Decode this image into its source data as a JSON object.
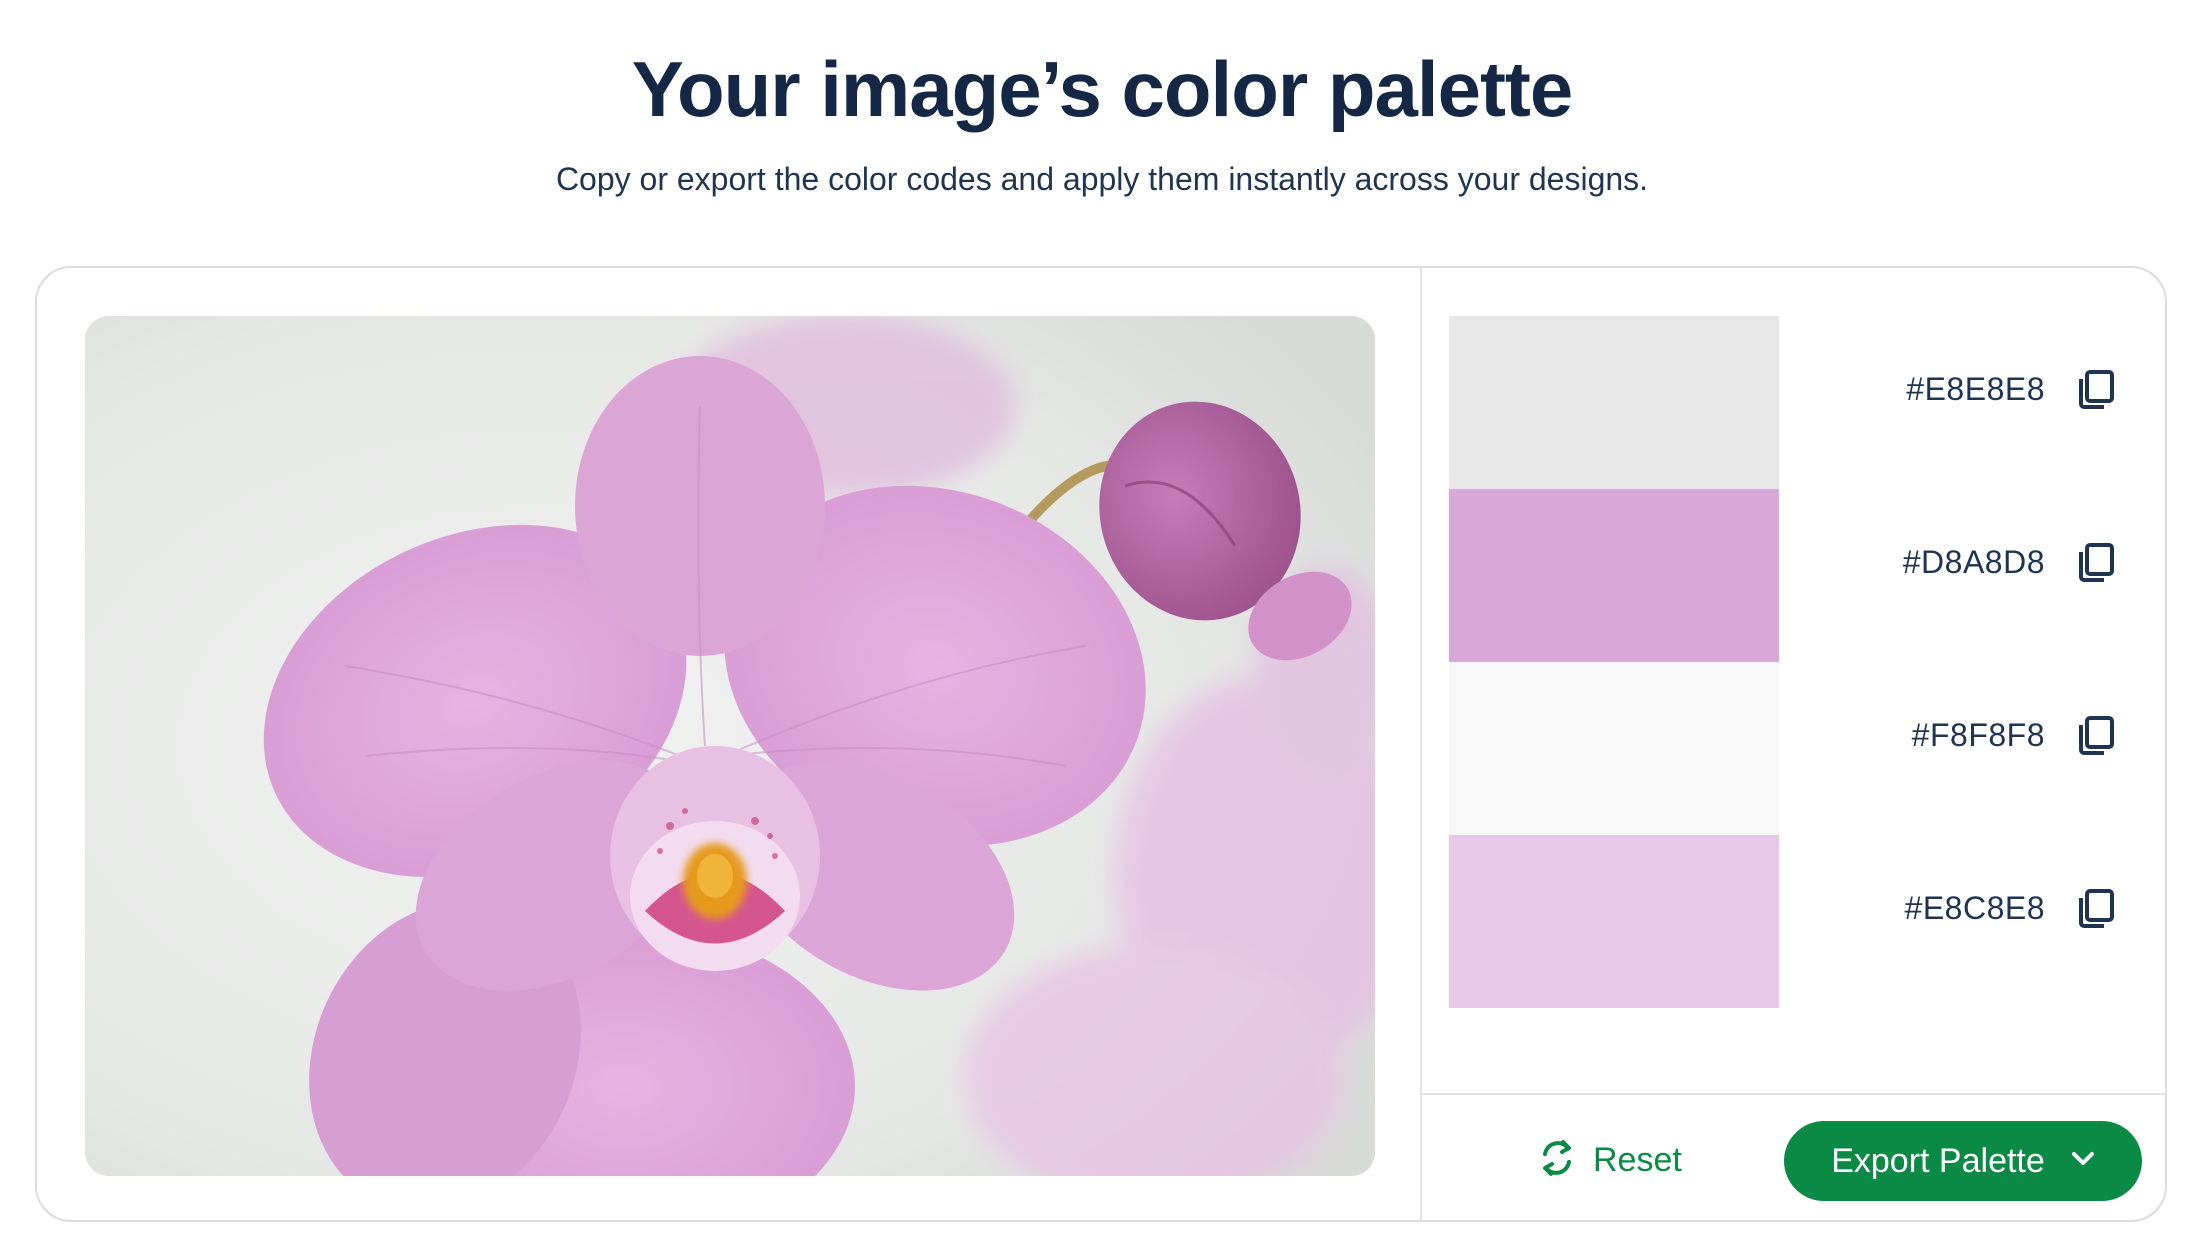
{
  "header": {
    "title": "Your image’s color palette",
    "subtitle": "Copy or export the color codes and apply them instantly across your designs."
  },
  "palette": [
    {
      "hex": "#E8E8E8",
      "color": "#E8E8E8",
      "icon": "copy-icon"
    },
    {
      "hex": "#D8A8D8",
      "color": "#D8A8D8",
      "icon": "copy-icon"
    },
    {
      "hex": "#F8F8F8",
      "color": "#F8F8F8",
      "icon": "copy-icon"
    },
    {
      "hex": "#E8C8E8",
      "color": "#E8C8E8",
      "icon": "copy-icon"
    }
  ],
  "actions": {
    "reset_label": "Reset",
    "reset_icon": "refresh-icon",
    "export_label": "Export Palette",
    "export_icon": "chevron-down-icon"
  },
  "colors": {
    "brand_green": "#0B8A45",
    "heading": "#142846"
  }
}
